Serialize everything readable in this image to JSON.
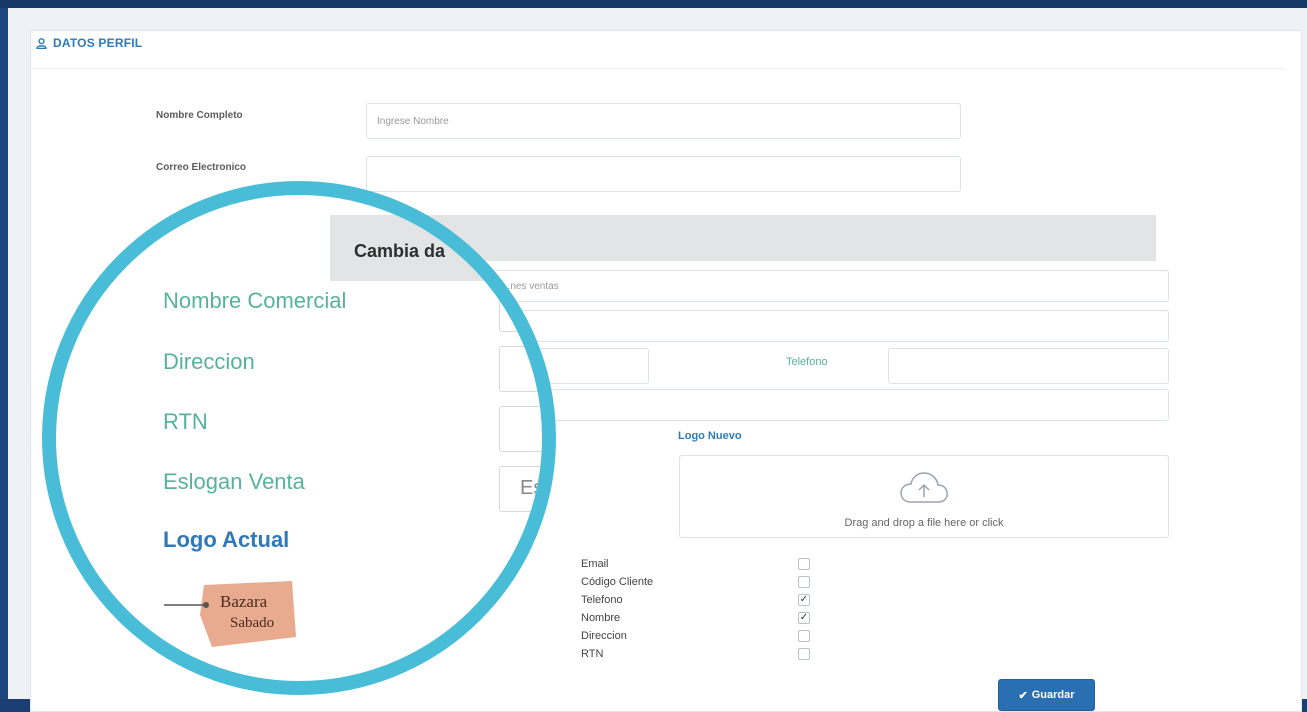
{
  "panel": {
    "title": "DATOS PERFIL",
    "icon": "user-icon"
  },
  "form": {
    "full_name": {
      "label": "Nombre Completo",
      "placeholder": "Ingrese Nombre",
      "value": ""
    },
    "email": {
      "label": "Correo Electronico",
      "placeholder": "",
      "value": ""
    }
  },
  "section": {
    "title": "Cambia da",
    "fields": {
      "nombre_comercial": {
        "label": "Nombre Comercial",
        "placeholder": "...nes ventas"
      },
      "direccion": {
        "label": "Direccion",
        "placeholder": ""
      },
      "rtn": {
        "label": "RTN",
        "placeholder": ""
      },
      "telefono": {
        "label": "Telefono",
        "placeholder": ""
      },
      "eslogan": {
        "label": "Eslogan Venta",
        "placeholder": "Es"
      }
    },
    "logo_actual": {
      "label": "Logo Actual",
      "image_text_top": "Bazara",
      "image_text_bottom": "Sabado"
    },
    "logo_nuevo": {
      "label": "Logo Nuevo",
      "dropzone_text": "Drag and drop a file here or click",
      "icon": "cloud-upload-icon"
    }
  },
  "checklist": [
    {
      "label": "Email",
      "checked": false
    },
    {
      "label": "Código Cliente",
      "checked": false
    },
    {
      "label": "Telefono",
      "checked": true
    },
    {
      "label": "Nombre",
      "checked": true
    },
    {
      "label": "Direccion",
      "checked": false
    },
    {
      "label": "RTN",
      "checked": false
    }
  ],
  "save_button": {
    "label": "Guardar",
    "icon": "check-icon"
  },
  "colors": {
    "accent_blue": "#2f79b8",
    "teal_label": "#56b39a",
    "magnifier_ring": "#49bdd8",
    "button_blue": "#2b6fb3"
  }
}
